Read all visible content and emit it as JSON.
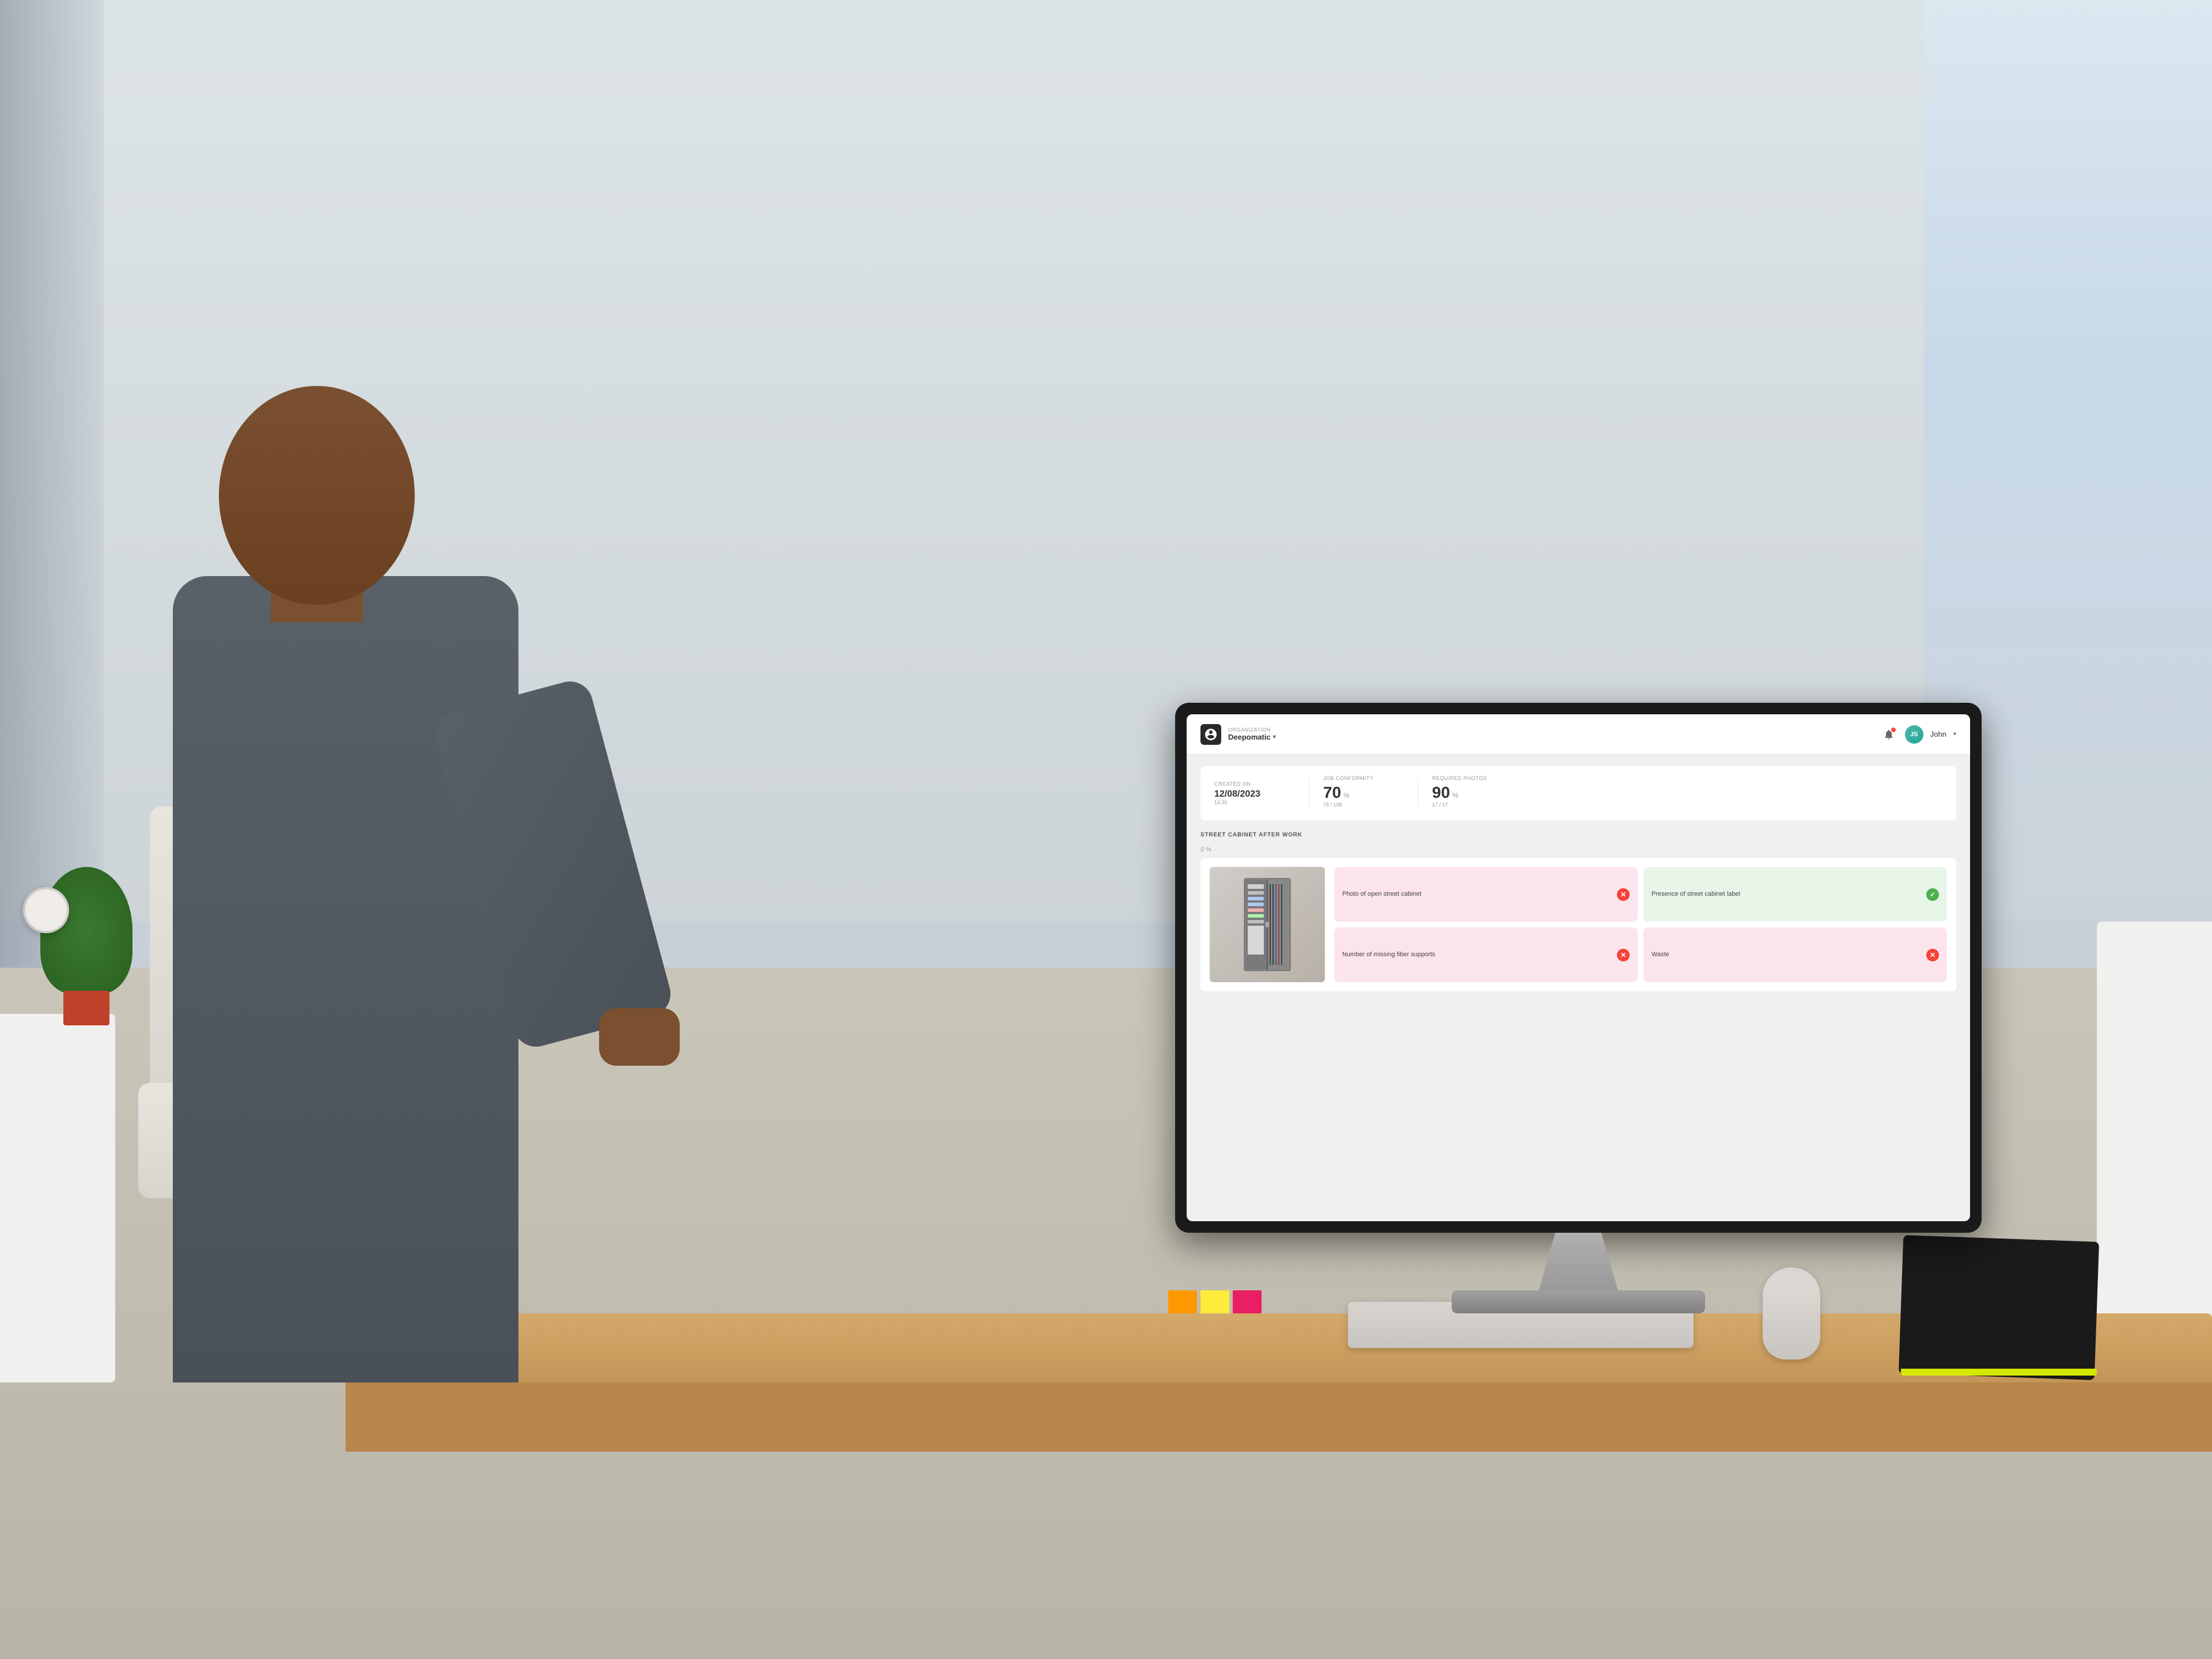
{
  "scene": {
    "description": "Man sitting at desk using computer in bright office"
  },
  "app": {
    "header": {
      "org_label": "ORGANIZATION",
      "org_name": "Deepomatic",
      "user_initials": "JS",
      "user_name": "John",
      "notification_icon": "bell-icon",
      "chevron_icon": "▾"
    },
    "stats": {
      "created_on_label": "CREATED ON",
      "created_on_value": "12/08/2023",
      "created_on_subtext": "14:30",
      "job_conformity_label": "JOB CONFORMITY",
      "job_conformity_value": "70",
      "job_conformity_unit": "%",
      "job_conformity_detail": "76 / 108",
      "job_conformity_progress": 70,
      "required_photos_label": "REQUIRED PHOTOS",
      "required_photos_value": "90",
      "required_photos_unit": "%",
      "required_photos_detail": "17 / 17",
      "required_photos_progress": 90
    },
    "section": {
      "title": "STREET CABINET AFTER WORK",
      "zero_percent": "0 %"
    },
    "cards": [
      {
        "id": "photo-open-cabinet",
        "label": "Photo of open street cabinet",
        "status": "error",
        "badge": "✕",
        "color": "pink"
      },
      {
        "id": "presence-street-cabinet-label",
        "label": "Presence of street cabinet label",
        "status": "success",
        "badge": "✓",
        "color": "green"
      },
      {
        "id": "missing-fiber-supports",
        "label": "Number of missing fiber supports",
        "status": "error",
        "badge": "✕",
        "color": "pink"
      },
      {
        "id": "waste",
        "label": "Waste",
        "status": "error",
        "badge": "✕",
        "color": "pink"
      }
    ]
  }
}
